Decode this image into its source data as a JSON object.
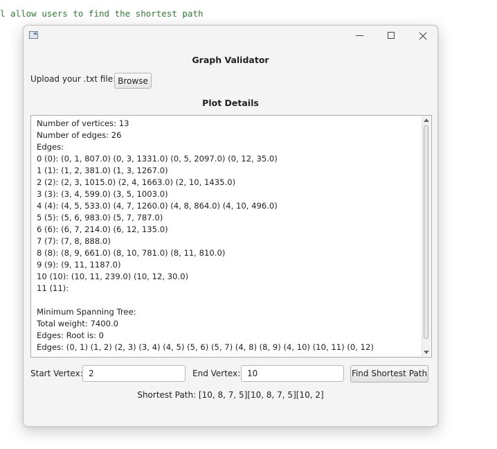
{
  "background": {
    "code_line": "l allow users to find the shortest path"
  },
  "window": {
    "title": "Graph Validator",
    "controls": {
      "minimize": "minimize-icon",
      "maximize": "maximize-icon",
      "close": "close-icon"
    }
  },
  "upload": {
    "label": "Upload your .txt file:",
    "browse_label": "Browse"
  },
  "plot": {
    "title": "Plot Details",
    "lines": [
      "Number of vertices: 13",
      "Number of edges: 26",
      "Edges:",
      "0 (0): (0, 1, 807.0) (0, 3, 1331.0) (0, 5, 2097.0) (0, 12, 35.0)",
      "1 (1): (1, 2, 381.0) (1, 3, 1267.0)",
      "2 (2): (2, 3, 1015.0) (2, 4, 1663.0) (2, 10, 1435.0)",
      "3 (3): (3, 4, 599.0) (3, 5, 1003.0)",
      "4 (4): (4, 5, 533.0) (4, 7, 1260.0) (4, 8, 864.0) (4, 10, 496.0)",
      "5 (5): (5, 6, 983.0) (5, 7, 787.0)",
      "6 (6): (6, 7, 214.0) (6, 12, 135.0)",
      "7 (7): (7, 8, 888.0)",
      "8 (8): (8, 9, 661.0) (8, 10, 781.0) (8, 11, 810.0)",
      "9 (9): (9, 11, 1187.0)",
      "10 (10): (10, 11, 239.0) (10, 12, 30.0)",
      "11 (11):",
      "",
      "Minimum Spanning Tree:",
      "Total weight: 7400.0",
      "Edges: Root is: 0",
      "Edges: (0, 1) (1, 2) (2, 3) (3, 4) (4, 5) (5, 6) (5, 7) (4, 8) (8, 9) (4, 10) (10, 11) (0, 12)"
    ]
  },
  "path_form": {
    "start_label": "Start Vertex:",
    "start_value": "2",
    "end_label": "End Vertex:",
    "end_value": "10",
    "find_label": "Find Shortest Path"
  },
  "result": "Shortest Path: [10, 8, 7, 5][10, 8, 7, 5][10, 2]"
}
